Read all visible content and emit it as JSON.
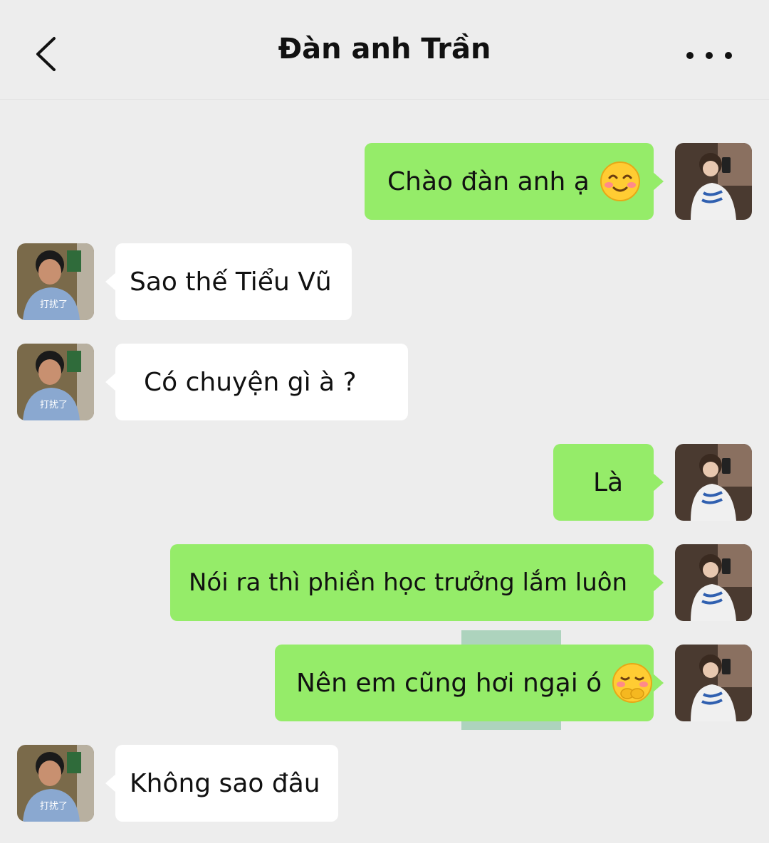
{
  "header": {
    "title": "Đàn anh Trần"
  },
  "messages": [
    {
      "side": "right",
      "text": "Chào đàn anh ạ",
      "emoji": "smiling-blush-emoji"
    },
    {
      "side": "left",
      "text": "Sao thế Tiểu Vũ",
      "avatar_caption": "打扰了"
    },
    {
      "side": "left",
      "text": "Có chuyện gì à ?",
      "avatar_caption": "打扰了"
    },
    {
      "side": "right",
      "text": "Là"
    },
    {
      "side": "right",
      "text": "Nói ra thì phiền học trưởng lắm luôn"
    },
    {
      "side": "right",
      "text": "Nên em cũng hơi ngại ó",
      "emoji": "shy-hand-over-mouth-emoji"
    },
    {
      "side": "left",
      "text": "Không sao đâu",
      "avatar_caption": "打扰了"
    }
  ],
  "colors": {
    "background": "#ededed",
    "sent_bubble": "#95ec69",
    "received_bubble": "#ffffff"
  },
  "icons": {
    "back": "chevron-left-icon",
    "more": "more-dots-icon"
  }
}
